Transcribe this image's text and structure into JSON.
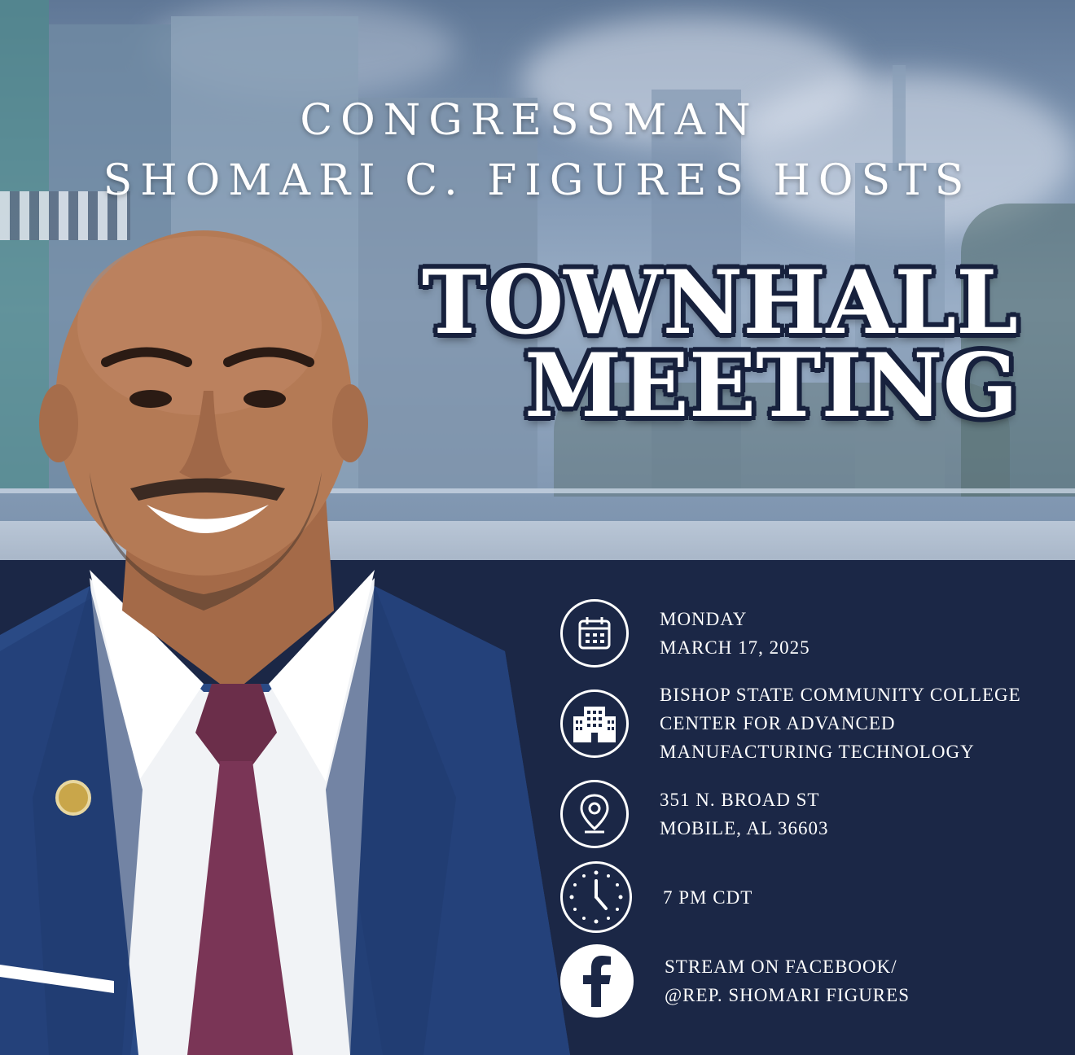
{
  "header": {
    "line1": "CONGRESSMAN",
    "line2": "SHOMARI C. FIGURES HOSTS"
  },
  "headline": {
    "line1": "TOWNHALL",
    "line2": "MEETING"
  },
  "details": {
    "date": {
      "icon": "calendar-icon",
      "lines": [
        "MONDAY",
        "MARCH 17, 2025"
      ]
    },
    "venue": {
      "icon": "building-icon",
      "lines": [
        "BISHOP STATE COMMUNITY COLLEGE",
        "CENTER FOR ADVANCED",
        "MANUFACTURING TECHNOLOGY"
      ]
    },
    "address": {
      "icon": "location-pin-icon",
      "lines": [
        "351 N. BROAD ST",
        "MOBILE, AL 36603"
      ]
    },
    "time": {
      "icon": "clock-icon",
      "lines": [
        "7 PM CDT"
      ]
    },
    "stream": {
      "icon": "facebook-icon",
      "lines": [
        "STREAM ON FACEBOOK/",
        "@REP. SHOMARI FIGURES"
      ]
    }
  },
  "colors": {
    "navy": "#1b2746",
    "white": "#ffffff",
    "suit": "#2a4a85",
    "skin": "#b47a55"
  }
}
